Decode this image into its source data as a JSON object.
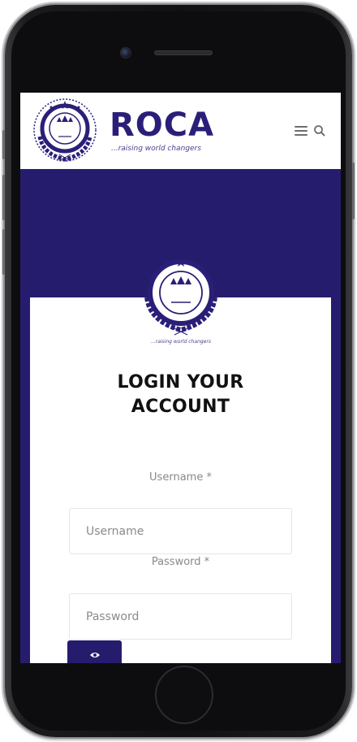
{
  "site": {
    "brand_name": "ROCA",
    "tagline": "...raising world changers",
    "badge_text": "ACADEMY",
    "badge_mark": "ROCA",
    "card_tagline": "...raising world changers"
  },
  "login": {
    "title_line1": "LOGIN YOUR",
    "title_line2": "ACCOUNT",
    "username_label": "Username *",
    "username_placeholder": "Username",
    "password_label": "Password *",
    "password_placeholder": "Password"
  },
  "colors": {
    "brand_navy": "#261c6e",
    "brand_text": "#2a1f78"
  },
  "icons": {
    "menu": "hamburger-icon",
    "search": "search-icon",
    "toggle": "eye-icon"
  }
}
